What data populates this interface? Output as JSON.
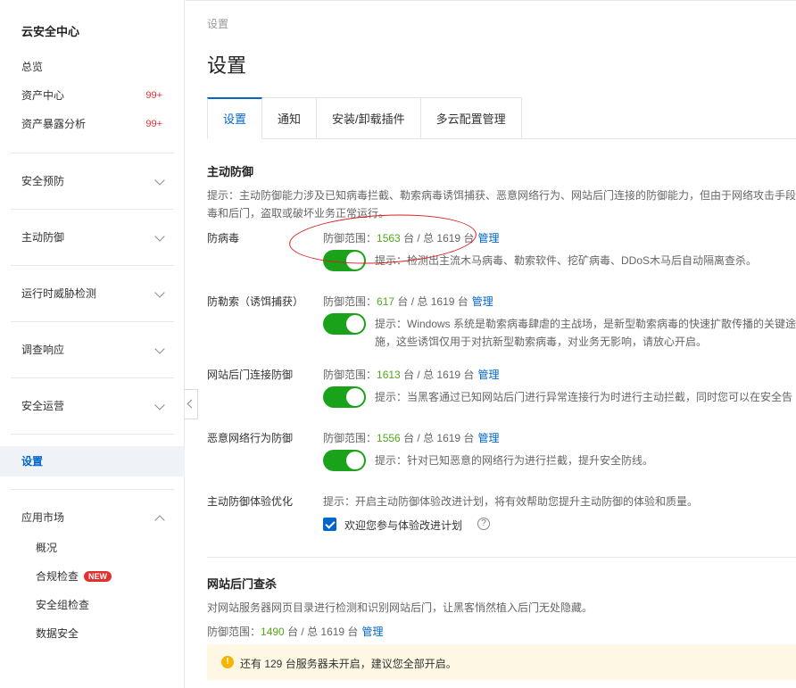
{
  "sidebar": {
    "title": "云安全中心",
    "items": [
      {
        "label": "总览",
        "badge": ""
      },
      {
        "label": "资产中心",
        "badge": "99+"
      },
      {
        "label": "资产暴露分析",
        "badge": "99+"
      }
    ],
    "groups": [
      "安全预防",
      "主动防御",
      "运行时威胁检测",
      "调查响应",
      "安全运营"
    ],
    "active": "设置",
    "market": {
      "label": "应用市场",
      "children": [
        "概况",
        "合规检查",
        "安全组检查",
        "数据安全"
      ],
      "new_badge": "NEW"
    }
  },
  "breadcrumb": "设置",
  "page_title": "设置",
  "tabs": [
    "设置",
    "通知",
    "安装/卸载插件",
    "多云配置管理"
  ],
  "active_defense": {
    "heading": "主动防御",
    "desc_line1": "提示：主动防御能力涉及已知病毒拦截、勒索病毒诱饵捕获、恶意网络行为、网站后门连接的防御能力，但由于网络攻击手段",
    "desc_line2": "毒和后门，盗取或破坏业务正常运行。",
    "range_prefix": "防御范围：",
    "total_text": "台 / 总 1619 台",
    "manage": "管理",
    "rows": [
      {
        "label": "防病毒",
        "count": "1563",
        "tip": "提示：检测出主流木马病毒、勒索软件、挖矿病毒、DDoS木马后自动隔离查杀。"
      },
      {
        "label": "防勒索（诱饵捕获）",
        "count": "617",
        "tip": "提示：Windows 系统是勒索病毒肆虐的主战场，是新型勒索病毒的快速扩散传播的关键途",
        "tip2": "施，这些诱饵仅用于对抗新型勒索病毒，对业务无影响，请放心开启。"
      },
      {
        "label": "网站后门连接防御",
        "count": "1613",
        "tip": "提示：当黑客通过已知网站后门进行异常连接行为时进行主动拦截，同时您可以在安全告"
      },
      {
        "label": "恶意网络行为防御",
        "count": "1556",
        "tip": "提示：针对已知恶意的网络行为进行拦截，提升安全防线。"
      }
    ],
    "experience": {
      "label": "主动防御体验优化",
      "tip": "提示：开启主动防御体验改进计划，将有效帮助您提升主动防御的体验和质量。",
      "checkbox_label": "欢迎您参与体验改进计划",
      "help": "?"
    }
  },
  "webshell": {
    "heading": "网站后门查杀",
    "desc": "对网站服务器网页目录进行检测和识别网站后门，让黑客悄然植入后门无处隐藏。",
    "count": "1490",
    "notice": "还有 129 台服务器未开启，建议您全部开启。",
    "warn_icon": "!"
  }
}
